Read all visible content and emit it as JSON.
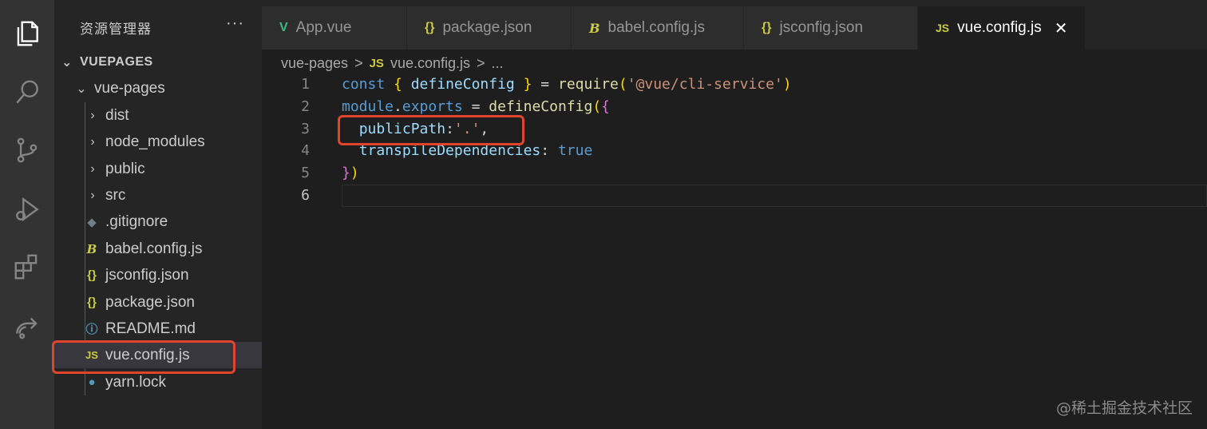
{
  "sidebar": {
    "header": "资源管理器",
    "more": "···",
    "root": "VUEPAGES",
    "folder": "vue-pages",
    "items": [
      {
        "label": "dist",
        "kind": "folder"
      },
      {
        "label": "node_modules",
        "kind": "folder"
      },
      {
        "label": "public",
        "kind": "folder"
      },
      {
        "label": "src",
        "kind": "folder"
      },
      {
        "label": ".gitignore",
        "kind": "git"
      },
      {
        "label": "babel.config.js",
        "kind": "babel"
      },
      {
        "label": "jsconfig.json",
        "kind": "json"
      },
      {
        "label": "package.json",
        "kind": "json"
      },
      {
        "label": "README.md",
        "kind": "info"
      },
      {
        "label": "vue.config.js",
        "kind": "js"
      },
      {
        "label": "yarn.lock",
        "kind": "yarn"
      }
    ]
  },
  "tabs": [
    {
      "label": "App.vue",
      "icon": "V"
    },
    {
      "label": "package.json",
      "icon": "{ }"
    },
    {
      "label": "babel.config.js",
      "icon": "B"
    },
    {
      "label": "jsconfig.json",
      "icon": "{ }"
    },
    {
      "label": "vue.config.js",
      "icon": "JS",
      "close": "✕"
    }
  ],
  "breadcrumb": {
    "folder": "vue-pages",
    "sep": ">",
    "file_icon": "JS",
    "file": "vue.config.js",
    "more": "..."
  },
  "editor": {
    "line_numbers": [
      "1",
      "2",
      "3",
      "4",
      "5",
      "6"
    ],
    "code": {
      "l1": {
        "a": "const",
        "b": "{",
        "c": "defineConfig",
        "d": "}",
        "e": "=",
        "f": "require",
        "g": "(",
        "h": "'@vue/cli-service'",
        "i": ")"
      },
      "l2": {
        "a": "module",
        "b": ".",
        "c": "exports",
        "d": "=",
        "e": "defineConfig",
        "f": "(",
        "g": "{"
      },
      "l3": {
        "a": "publicPath",
        "b": ":",
        "c": "'.'",
        "d": ","
      },
      "l4": {
        "a": "transpileDependencies",
        "b": ":",
        "c": "true"
      },
      "l5": {
        "a": "}",
        "b": ")"
      }
    }
  },
  "watermark": "@稀土掘金技术社区",
  "colors": {
    "highlight": "#e0442d",
    "js_icon": "#cbcb41",
    "vue_icon": "#41b883",
    "json_icon": "#cbcb41"
  }
}
